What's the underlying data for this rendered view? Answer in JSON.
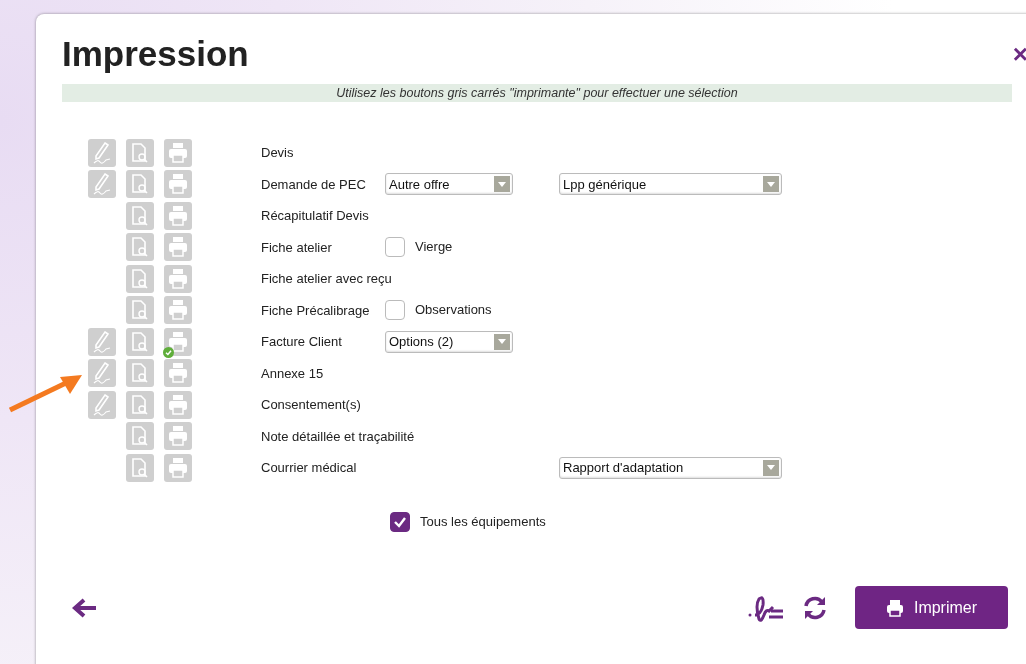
{
  "dialog": {
    "title": "Impression",
    "close": "×",
    "hint": "Utilisez les boutons gris carrés \"imprimante\" pour effectuer une sélection"
  },
  "documents": [
    {
      "label": "Devis",
      "signable": true,
      "printed": false
    },
    {
      "label": "Demande de PEC",
      "signable": true,
      "printed": false,
      "column_2": {
        "kind": "select",
        "value": "Autre offre"
      },
      "column_3": {
        "kind": "select",
        "value": "Lpp générique"
      }
    },
    {
      "label": "Récapitulatif Devis",
      "signable": false,
      "printed": false
    },
    {
      "label": "Fiche atelier",
      "signable": false,
      "printed": false,
      "column_2": {
        "kind": "checkbox",
        "label": "Vierge",
        "checked": false
      }
    },
    {
      "label": "Fiche atelier avec reçu",
      "signable": false,
      "printed": false
    },
    {
      "label": "Fiche Précalibrage",
      "signable": false,
      "printed": false,
      "column_2": {
        "kind": "checkbox",
        "label": "Observations",
        "checked": false
      }
    },
    {
      "label": "Facture Client",
      "signable": true,
      "printed": true,
      "column_2": {
        "kind": "select",
        "value": "Options (2)"
      }
    },
    {
      "label": "Annexe 15",
      "signable": true,
      "printed": false
    },
    {
      "label": "Consentement(s)",
      "signable": true,
      "printed": false
    },
    {
      "label": "Note détaillée et traçabilité",
      "signable": false,
      "printed": false
    },
    {
      "label": "Courrier médical",
      "signable": false,
      "printed": false,
      "column_3": {
        "kind": "select",
        "value": "Rapport d'adaptation"
      }
    }
  ],
  "all_equipment": {
    "label": "Tous les équipements",
    "checked": true
  },
  "footer": {
    "print_button": "Imprimer"
  }
}
